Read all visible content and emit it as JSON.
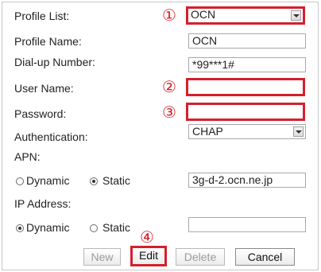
{
  "form": {
    "profile_list_label": "Profile List:",
    "profile_list_value": "OCN",
    "profile_name_label": "Profile Name:",
    "profile_name_value": "OCN",
    "dialup_label": "Dial-up Number:",
    "dialup_value": "*99***1#",
    "username_label": "User Name:",
    "username_value": "",
    "password_label": "Password:",
    "password_value": "",
    "auth_label": "Authentication:",
    "auth_value": "CHAP",
    "apn_label": "APN:",
    "apn_dynamic_label": "Dynamic",
    "apn_static_label": "Static",
    "apn_mode": "Static",
    "apn_value": "3g-d-2.ocn.ne.jp",
    "ip_label": "IP Address:",
    "ip_dynamic_label": "Dynamic",
    "ip_static_label": "Static",
    "ip_mode": "Dynamic",
    "ip_value": ""
  },
  "annotations": {
    "n1": "①",
    "n2": "②",
    "n3": "③",
    "n4": "④",
    "color": "#d4202c"
  },
  "buttons": {
    "new_label": "New",
    "edit_label": "Edit",
    "delete_label": "Delete",
    "cancel_label": "Cancel"
  }
}
